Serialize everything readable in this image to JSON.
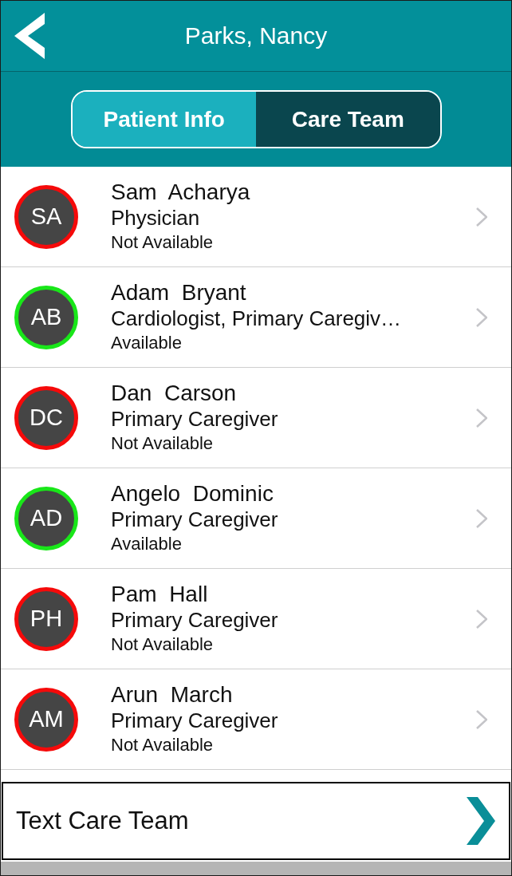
{
  "header": {
    "title": "Parks, Nancy"
  },
  "tabs": [
    {
      "label": "Patient Info",
      "selected": false
    },
    {
      "label": "Care Team",
      "selected": true
    }
  ],
  "members": [
    {
      "initials": "SA",
      "name": "Sam  Acharya",
      "role": "Physician",
      "status": "Not Available",
      "available": false
    },
    {
      "initials": "AB",
      "name": "Adam  Bryant",
      "role": "Cardiologist, Primary Caregiv…",
      "status": "Available",
      "available": true
    },
    {
      "initials": "DC",
      "name": "Dan  Carson",
      "role": "Primary Caregiver",
      "status": "Not Available",
      "available": false
    },
    {
      "initials": "AD",
      "name": "Angelo  Dominic",
      "role": "Primary Caregiver",
      "status": "Available",
      "available": true
    },
    {
      "initials": "PH",
      "name": "Pam  Hall",
      "role": "Primary Caregiver",
      "status": "Not Available",
      "available": false
    },
    {
      "initials": "AM",
      "name": "Arun  March",
      "role": "Primary Caregiver",
      "status": "Not Available",
      "available": false
    }
  ],
  "footer_button": {
    "label": "Text Care Team"
  }
}
